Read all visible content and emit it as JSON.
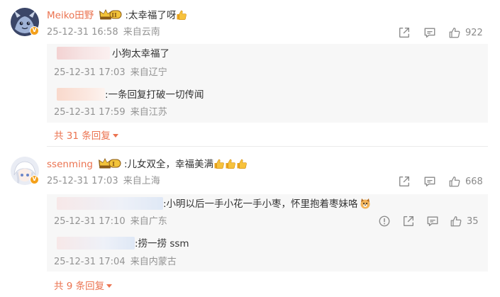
{
  "comments": [
    {
      "username": "Meiko田野",
      "level": "II",
      "text": ":太幸福了呀",
      "time": "25-12-31 16:58",
      "location": "来自云南",
      "likes": "922",
      "replies": [
        {
          "text": "小狗太幸福了",
          "time": "25-12-31 17:03",
          "location": "来自辽宁"
        },
        {
          "text": ":一条回复打破一切传闻",
          "time": "25-12-31 17:59",
          "location": "来自江苏"
        }
      ],
      "more": "共 31 条回复"
    },
    {
      "username": "ssenming",
      "level": "I",
      "text": ":儿女双全，幸福美满",
      "time": "25-12-31 17:03",
      "location": "来自上海",
      "likes": "668",
      "replies": [
        {
          "text": ":小明以后一手小花一手小枣，怀里抱着枣妹咯",
          "time": "25-12-31 17:10",
          "location": "来自广东",
          "likes": "35"
        },
        {
          "text": ":捞一捞 ssm",
          "time": "25-12-31 17:04",
          "location": "来自内蒙古"
        }
      ],
      "more": "共 9 条回复"
    }
  ],
  "icons": {
    "share": "share-icon",
    "comment": "comment-icon",
    "like": "thumbs-up-icon",
    "report": "report-icon",
    "thumb_emoji": "thumbs-up-emoji",
    "dog_emoji": "dog-emoji",
    "crown": "crown-badge-icon"
  },
  "colors": {
    "username": "#eb7350",
    "meta": "#939393",
    "reply_bg": "#f7f7f7",
    "verified": "#f4a01a"
  }
}
